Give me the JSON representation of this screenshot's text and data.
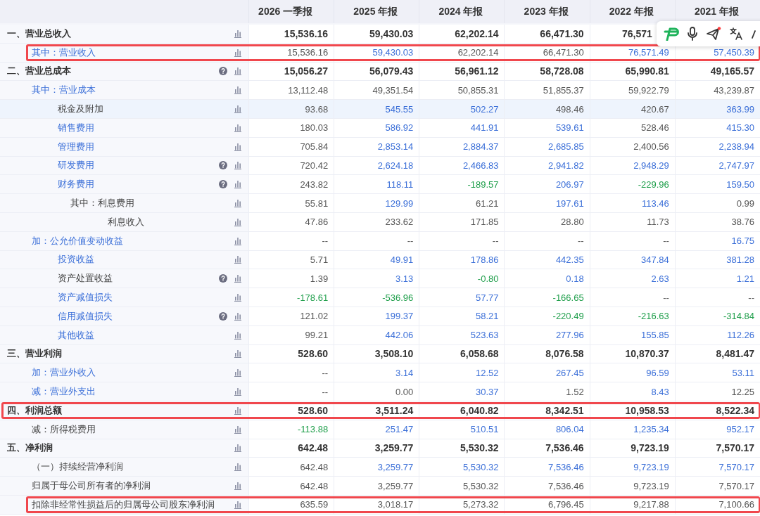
{
  "table": {
    "columns": [
      "2026 一季报",
      "2025 年报",
      "2024 年报",
      "2023 年报",
      "2022 年报",
      "2021 年报"
    ],
    "rows": [
      {
        "label": "一、营业总收入",
        "link": false,
        "help": false,
        "highlighted": false,
        "hovered": false,
        "cells": [
          {
            "text": "15,536.16",
            "kind": "plain"
          },
          {
            "text": "59,430.03",
            "kind": "plain"
          },
          {
            "text": "62,202.14",
            "kind": "plain"
          },
          {
            "text": "66,471.30",
            "kind": "plain"
          },
          {
            "text": "76,571",
            "kind": "clipped"
          },
          null
        ],
        "children": [
          {
            "label": "其中：营业收入",
            "link": true,
            "help": false,
            "highlighted": true,
            "hovered": false,
            "cells": [
              {
                "text": "15,536.16",
                "kind": "plain"
              },
              {
                "text": "59,430.03",
                "kind": "link"
              },
              {
                "text": "62,202.14",
                "kind": "plain"
              },
              {
                "text": "66,471.30",
                "kind": "plain"
              },
              {
                "text": "76,571.49",
                "kind": "link"
              },
              {
                "text": "57,450.39",
                "kind": "link"
              }
            ]
          }
        ]
      },
      {
        "label": "二、营业总成本",
        "link": false,
        "help": true,
        "highlighted": false,
        "hovered": false,
        "cells": [
          {
            "text": "15,056.27",
            "kind": "plain"
          },
          {
            "text": "56,079.43",
            "kind": "plain"
          },
          {
            "text": "56,961.12",
            "kind": "plain"
          },
          {
            "text": "58,728.08",
            "kind": "plain"
          },
          {
            "text": "65,990.81",
            "kind": "plain"
          },
          {
            "text": "49,165.57",
            "kind": "plain"
          }
        ],
        "children": [
          {
            "label": "其中：营业成本",
            "link": true,
            "help": false,
            "highlighted": false,
            "hovered": false,
            "cells": [
              {
                "text": "13,112.48",
                "kind": "plain"
              },
              {
                "text": "49,351.54",
                "kind": "plain"
              },
              {
                "text": "50,855.31",
                "kind": "plain"
              },
              {
                "text": "51,855.37",
                "kind": "plain"
              },
              {
                "text": "59,922.79",
                "kind": "plain"
              },
              {
                "text": "43,239.87",
                "kind": "plain"
              }
            ],
            "children": [
              {
                "label": "税金及附加",
                "link": false,
                "help": false,
                "highlighted": false,
                "hovered": true,
                "cells": [
                  {
                    "text": "93.68",
                    "kind": "plain"
                  },
                  {
                    "text": "545.55",
                    "kind": "link"
                  },
                  {
                    "text": "502.27",
                    "kind": "link"
                  },
                  {
                    "text": "498.46",
                    "kind": "plain"
                  },
                  {
                    "text": "420.67",
                    "kind": "plain"
                  },
                  {
                    "text": "363.99",
                    "kind": "link"
                  }
                ]
              },
              {
                "label": "销售费用",
                "link": true,
                "help": false,
                "highlighted": false,
                "hovered": false,
                "cells": [
                  {
                    "text": "180.03",
                    "kind": "plain"
                  },
                  {
                    "text": "586.92",
                    "kind": "link"
                  },
                  {
                    "text": "441.91",
                    "kind": "link"
                  },
                  {
                    "text": "539.61",
                    "kind": "link"
                  },
                  {
                    "text": "528.46",
                    "kind": "plain"
                  },
                  {
                    "text": "415.30",
                    "kind": "link"
                  }
                ]
              },
              {
                "label": "管理费用",
                "link": true,
                "help": false,
                "highlighted": false,
                "hovered": false,
                "cells": [
                  {
                    "text": "705.84",
                    "kind": "plain"
                  },
                  {
                    "text": "2,853.14",
                    "kind": "link"
                  },
                  {
                    "text": "2,884.37",
                    "kind": "link"
                  },
                  {
                    "text": "2,685.85",
                    "kind": "link"
                  },
                  {
                    "text": "2,400.56",
                    "kind": "plain"
                  },
                  {
                    "text": "2,238.94",
                    "kind": "link"
                  }
                ]
              },
              {
                "label": "研发费用",
                "link": true,
                "help": true,
                "highlighted": false,
                "hovered": false,
                "cells": [
                  {
                    "text": "720.42",
                    "kind": "plain"
                  },
                  {
                    "text": "2,624.18",
                    "kind": "link"
                  },
                  {
                    "text": "2,466.83",
                    "kind": "link"
                  },
                  {
                    "text": "2,941.82",
                    "kind": "link"
                  },
                  {
                    "text": "2,948.29",
                    "kind": "link"
                  },
                  {
                    "text": "2,747.97",
                    "kind": "link"
                  }
                ]
              },
              {
                "label": "财务费用",
                "link": true,
                "help": true,
                "highlighted": false,
                "hovered": false,
                "cells": [
                  {
                    "text": "243.82",
                    "kind": "plain"
                  },
                  {
                    "text": "118.11",
                    "kind": "link"
                  },
                  {
                    "text": "-189.57",
                    "kind": "negative"
                  },
                  {
                    "text": "206.97",
                    "kind": "link"
                  },
                  {
                    "text": "-229.96",
                    "kind": "negative"
                  },
                  {
                    "text": "159.50",
                    "kind": "link"
                  }
                ],
                "children": [
                  {
                    "label": "其中：利息费用",
                    "link": false,
                    "help": false,
                    "highlighted": false,
                    "hovered": false,
                    "cells": [
                      {
                        "text": "55.81",
                        "kind": "plain"
                      },
                      {
                        "text": "129.99",
                        "kind": "link"
                      },
                      {
                        "text": "61.21",
                        "kind": "plain"
                      },
                      {
                        "text": "197.61",
                        "kind": "link"
                      },
                      {
                        "text": "113.46",
                        "kind": "link"
                      },
                      {
                        "text": "0.99",
                        "kind": "plain"
                      }
                    ],
                    "children": [
                      {
                        "label": "利息收入",
                        "link": false,
                        "help": false,
                        "highlighted": false,
                        "hovered": false,
                        "cells": [
                          {
                            "text": "47.86",
                            "kind": "plain"
                          },
                          {
                            "text": "233.62",
                            "kind": "plain"
                          },
                          {
                            "text": "171.85",
                            "kind": "plain"
                          },
                          {
                            "text": "28.80",
                            "kind": "plain"
                          },
                          {
                            "text": "11.73",
                            "kind": "plain"
                          },
                          {
                            "text": "38.76",
                            "kind": "plain"
                          }
                        ]
                      }
                    ]
                  }
                ]
              }
            ]
          },
          {
            "label": "加：公允价值变动收益",
            "link": true,
            "help": false,
            "highlighted": false,
            "hovered": false,
            "cells": [
              {
                "text": "--",
                "kind": "plain"
              },
              {
                "text": "--",
                "kind": "plain"
              },
              {
                "text": "--",
                "kind": "plain"
              },
              {
                "text": "--",
                "kind": "plain"
              },
              {
                "text": "--",
                "kind": "plain"
              },
              {
                "text": "16.75",
                "kind": "link"
              }
            ],
            "children": [
              {
                "label": "投资收益",
                "link": true,
                "help": false,
                "highlighted": false,
                "hovered": false,
                "cells": [
                  {
                    "text": "5.71",
                    "kind": "plain"
                  },
                  {
                    "text": "49.91",
                    "kind": "link"
                  },
                  {
                    "text": "178.86",
                    "kind": "link"
                  },
                  {
                    "text": "442.35",
                    "kind": "link"
                  },
                  {
                    "text": "347.84",
                    "kind": "link"
                  },
                  {
                    "text": "381.28",
                    "kind": "link"
                  }
                ]
              },
              {
                "label": "资产处置收益",
                "link": false,
                "help": true,
                "highlighted": false,
                "hovered": false,
                "cells": [
                  {
                    "text": "1.39",
                    "kind": "plain"
                  },
                  {
                    "text": "3.13",
                    "kind": "link"
                  },
                  {
                    "text": "-0.80",
                    "kind": "negative"
                  },
                  {
                    "text": "0.18",
                    "kind": "link"
                  },
                  {
                    "text": "2.63",
                    "kind": "link"
                  },
                  {
                    "text": "1.21",
                    "kind": "link"
                  }
                ]
              },
              {
                "label": "资产减值损失",
                "link": true,
                "help": false,
                "highlighted": false,
                "hovered": false,
                "cells": [
                  {
                    "text": "-178.61",
                    "kind": "negative"
                  },
                  {
                    "text": "-536.96",
                    "kind": "negative"
                  },
                  {
                    "text": "57.77",
                    "kind": "link"
                  },
                  {
                    "text": "-166.65",
                    "kind": "negative"
                  },
                  {
                    "text": "--",
                    "kind": "plain"
                  },
                  {
                    "text": "--",
                    "kind": "plain"
                  }
                ]
              },
              {
                "label": "信用减值损失",
                "link": true,
                "help": true,
                "highlighted": false,
                "hovered": false,
                "cells": [
                  {
                    "text": "121.02",
                    "kind": "plain"
                  },
                  {
                    "text": "199.37",
                    "kind": "link"
                  },
                  {
                    "text": "58.21",
                    "kind": "link"
                  },
                  {
                    "text": "-220.49",
                    "kind": "negative"
                  },
                  {
                    "text": "-216.63",
                    "kind": "negative"
                  },
                  {
                    "text": "-314.84",
                    "kind": "negative"
                  }
                ]
              },
              {
                "label": "其他收益",
                "link": true,
                "help": false,
                "highlighted": false,
                "hovered": false,
                "cells": [
                  {
                    "text": "99.21",
                    "kind": "plain"
                  },
                  {
                    "text": "442.06",
                    "kind": "link"
                  },
                  {
                    "text": "523.63",
                    "kind": "link"
                  },
                  {
                    "text": "277.96",
                    "kind": "link"
                  },
                  {
                    "text": "155.85",
                    "kind": "link"
                  },
                  {
                    "text": "112.26",
                    "kind": "link"
                  }
                ]
              }
            ]
          }
        ]
      },
      {
        "label": "三、营业利润",
        "link": false,
        "help": false,
        "highlighted": false,
        "hovered": false,
        "cells": [
          {
            "text": "528.60",
            "kind": "plain"
          },
          {
            "text": "3,508.10",
            "kind": "plain"
          },
          {
            "text": "6,058.68",
            "kind": "plain"
          },
          {
            "text": "8,076.58",
            "kind": "plain"
          },
          {
            "text": "10,870.37",
            "kind": "plain"
          },
          {
            "text": "8,481.47",
            "kind": "plain"
          }
        ],
        "children": [
          {
            "label": "加：营业外收入",
            "link": true,
            "help": false,
            "highlighted": false,
            "hovered": false,
            "cells": [
              {
                "text": "--",
                "kind": "plain"
              },
              {
                "text": "3.14",
                "kind": "link"
              },
              {
                "text": "12.52",
                "kind": "link"
              },
              {
                "text": "267.45",
                "kind": "link"
              },
              {
                "text": "96.59",
                "kind": "link"
              },
              {
                "text": "53.11",
                "kind": "link"
              }
            ]
          },
          {
            "label": "减：营业外支出",
            "link": true,
            "help": false,
            "highlighted": false,
            "hovered": false,
            "cells": [
              {
                "text": "--",
                "kind": "plain"
              },
              {
                "text": "0.00",
                "kind": "plain"
              },
              {
                "text": "30.37",
                "kind": "link"
              },
              {
                "text": "1.52",
                "kind": "plain"
              },
              {
                "text": "8.43",
                "kind": "link"
              },
              {
                "text": "12.25",
                "kind": "plain"
              }
            ]
          }
        ]
      },
      {
        "label": "四、利润总额",
        "link": false,
        "help": false,
        "highlighted": true,
        "hovered": false,
        "cells": [
          {
            "text": "528.60",
            "kind": "plain"
          },
          {
            "text": "3,511.24",
            "kind": "plain"
          },
          {
            "text": "6,040.82",
            "kind": "plain"
          },
          {
            "text": "8,342.51",
            "kind": "plain"
          },
          {
            "text": "10,958.53",
            "kind": "plain"
          },
          {
            "text": "8,522.34",
            "kind": "plain"
          }
        ],
        "children": [
          {
            "label": "减：所得税费用",
            "link": false,
            "help": false,
            "highlighted": false,
            "hovered": false,
            "cells": [
              {
                "text": "-113.88",
                "kind": "negative"
              },
              {
                "text": "251.47",
                "kind": "link"
              },
              {
                "text": "510.51",
                "kind": "link"
              },
              {
                "text": "806.04",
                "kind": "link"
              },
              {
                "text": "1,235.34",
                "kind": "link"
              },
              {
                "text": "952.17",
                "kind": "link"
              }
            ]
          }
        ]
      },
      {
        "label": "五、净利润",
        "link": false,
        "help": false,
        "highlighted": false,
        "hovered": false,
        "cells": [
          {
            "text": "642.48",
            "kind": "plain"
          },
          {
            "text": "3,259.77",
            "kind": "plain"
          },
          {
            "text": "5,530.32",
            "kind": "plain"
          },
          {
            "text": "7,536.46",
            "kind": "plain"
          },
          {
            "text": "9,723.19",
            "kind": "plain"
          },
          {
            "text": "7,570.17",
            "kind": "plain"
          }
        ],
        "children": [
          {
            "label": "（一）持续经营净利润",
            "link": false,
            "help": false,
            "highlighted": false,
            "hovered": false,
            "cells": [
              {
                "text": "642.48",
                "kind": "plain"
              },
              {
                "text": "3,259.77",
                "kind": "link"
              },
              {
                "text": "5,530.32",
                "kind": "link"
              },
              {
                "text": "7,536.46",
                "kind": "link"
              },
              {
                "text": "9,723.19",
                "kind": "link"
              },
              {
                "text": "7,570.17",
                "kind": "link"
              }
            ]
          },
          {
            "label": "归属于母公司所有者的净利润",
            "link": false,
            "help": false,
            "highlighted": false,
            "hovered": false,
            "cells": [
              {
                "text": "642.48",
                "kind": "plain"
              },
              {
                "text": "3,259.77",
                "kind": "plain"
              },
              {
                "text": "5,530.32",
                "kind": "plain"
              },
              {
                "text": "7,536.46",
                "kind": "plain"
              },
              {
                "text": "9,723.19",
                "kind": "plain"
              },
              {
                "text": "7,570.17",
                "kind": "plain"
              }
            ]
          },
          {
            "label": "扣除非经常性损益后的归属母公司股东净利润",
            "link": false,
            "help": false,
            "highlighted": true,
            "hovered": false,
            "cells": [
              {
                "text": "635.59",
                "kind": "plain"
              },
              {
                "text": "3,018.17",
                "kind": "plain"
              },
              {
                "text": "5,273.32",
                "kind": "plain"
              },
              {
                "text": "6,796.45",
                "kind": "plain"
              },
              {
                "text": "9,217.88",
                "kind": "plain"
              },
              {
                "text": "7,100.66",
                "kind": "plain"
              }
            ]
          }
        ]
      }
    ]
  },
  "toolbar": {
    "notification": true
  }
}
